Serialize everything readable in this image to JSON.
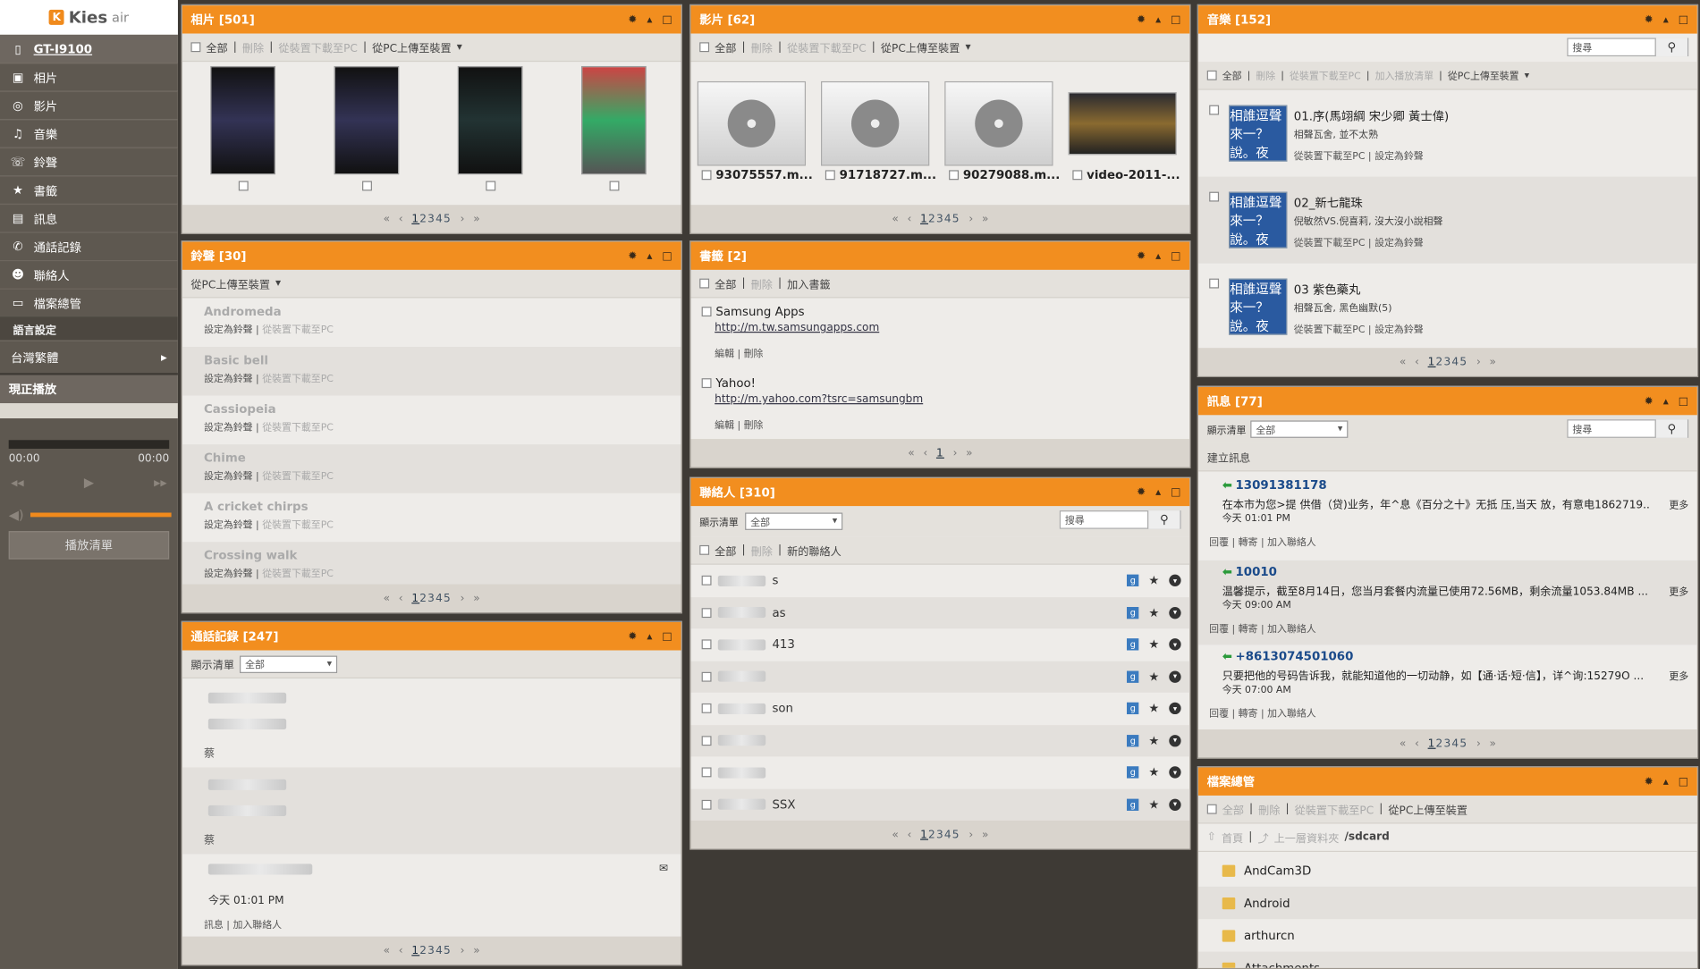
{
  "app": {
    "logo_mark": "K",
    "logo_text": "Kies",
    "logo_air": "air"
  },
  "sidebar": {
    "device": "GT-I9100",
    "items": [
      {
        "label": "相片",
        "icon": "photo-icon"
      },
      {
        "label": "影片",
        "icon": "video-icon"
      },
      {
        "label": "音樂",
        "icon": "music-icon"
      },
      {
        "label": "鈴聲",
        "icon": "ringtone-icon"
      },
      {
        "label": "書籤",
        "icon": "bookmark-icon"
      },
      {
        "label": "訊息",
        "icon": "message-icon"
      },
      {
        "label": "通話記錄",
        "icon": "call-log-icon"
      },
      {
        "label": "聯絡人",
        "icon": "contact-icon"
      },
      {
        "label": "檔案總管",
        "icon": "folder-icon"
      }
    ],
    "lang_header": "語言設定",
    "lang_value": "台灣繁體",
    "now_playing": "現正播放",
    "time_start": "00:00",
    "time_end": "00:00",
    "playlist": "播放清單"
  },
  "common": {
    "all": "全部",
    "delete": "刪除",
    "download": "從裝置下載至PC",
    "upload": "從PC上傳至裝置",
    "set_ring": "設定為鈴聲",
    "edit": "編輯",
    "reply": "回覆",
    "forward": "轉寄",
    "add_contact": "加入聯絡人",
    "more": "更多",
    "show_list": "顯示清單",
    "search": "搜尋",
    "pages": "12345",
    "page_first": "1",
    "page_rest": "2345"
  },
  "photos": {
    "title": "相片 [501]"
  },
  "videos": {
    "title": "影片 [62]",
    "items": [
      "93075557.m...",
      "91718727.m...",
      "90279088.m...",
      "video-2011-..."
    ]
  },
  "music": {
    "title": "音樂 [152]",
    "add_playlist": "加入播放清單",
    "set_ring": "設定為鈴聲",
    "items": [
      {
        "title": "01.序(馬翊綱 宋少卿 黃士偉)",
        "sub": "相聲瓦舍, 並不太熟"
      },
      {
        "title": "02_新七龍珠",
        "sub": "倪敏然VS.倪喜莉, 沒大沒小說相聲"
      },
      {
        "title": "03 紫色藥丸",
        "sub": "相聲瓦舍, 黑色幽默(5)"
      }
    ],
    "art_text": "相誰逗聲來一？說。夜"
  },
  "ringtones": {
    "title": "鈴聲 [30]",
    "items": [
      "Andromeda",
      "Basic bell",
      "Cassiopeia",
      "Chime",
      "A cricket chirps",
      "Crossing walk"
    ]
  },
  "bookmarks": {
    "title": "書籤 [2]",
    "add": "加入書籤",
    "items": [
      {
        "name": "Samsung Apps",
        "url": "http://m.tw.samsungapps.com"
      },
      {
        "name": "Yahoo!",
        "url": "http://m.yahoo.com?tsrc=samsungbm"
      }
    ],
    "page": "1"
  },
  "messages": {
    "title": "訊息 [77]",
    "new": "建立訊息",
    "filter": "全部",
    "items": [
      {
        "number": "13091381178",
        "body": "在本市为您>提 供借（贷)业务，年^息《百分之十》无抵 压,当天 放，有意电1862719...",
        "time": "今天 01:01 PM"
      },
      {
        "number": "10010",
        "body": "温馨提示，截至8月14日，您当月套餐内流量已使用72.56MB，剩余流量1053.84MB ...",
        "time": "今天 09:00 AM"
      },
      {
        "number": "+8613074501060",
        "body": "只要把他的号码告诉我，就能知道他的一切动静，如【通·话·短·信】，详^询:15279O ...",
        "time": "今天 07:00 AM"
      }
    ]
  },
  "contacts": {
    "title": "聯絡人 [310]",
    "filter": "全部",
    "new": "新的聯絡人",
    "items": [
      "s",
      "as",
      "413",
      "",
      "son",
      "",
      "",
      "SSX"
    ]
  },
  "call_log": {
    "title": "通話記錄 [247]",
    "filter": "全部",
    "time": "今天 01:01 PM",
    "msg": "訊息",
    "initial": "蔡"
  },
  "file_manager": {
    "title": "檔案總管",
    "home": "首頁",
    "up": "上一層資料夾",
    "path": "/sdcard",
    "items": [
      "AndCam3D",
      "Android",
      "arthurcn",
      "Attachments"
    ]
  }
}
